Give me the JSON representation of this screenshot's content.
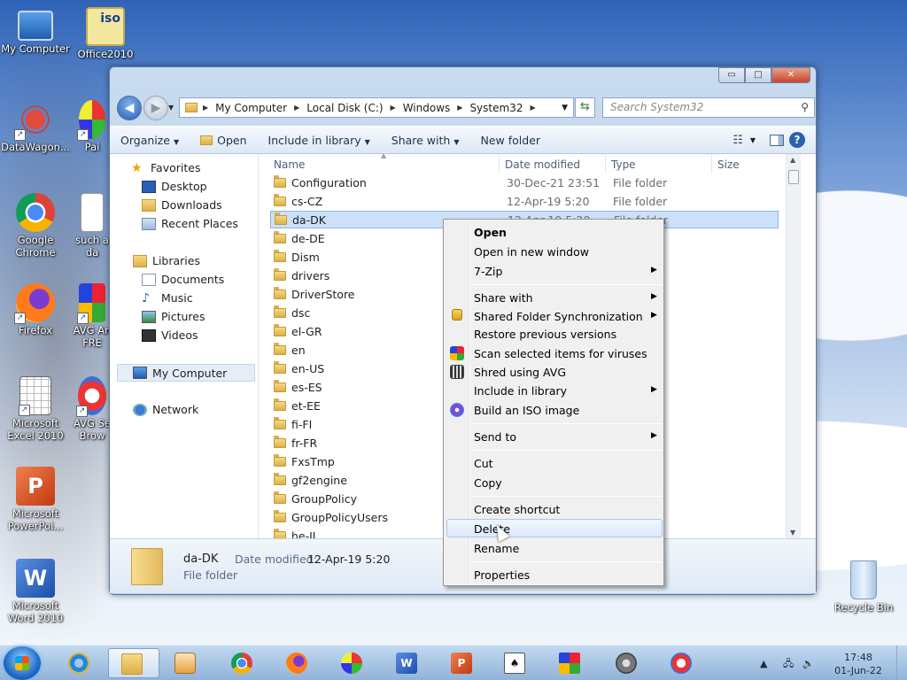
{
  "desktop": {
    "icons": [
      {
        "label": "My Computer"
      },
      {
        "label": "Office2010"
      },
      {
        "label": "DataWagon..."
      },
      {
        "label": "Pai"
      },
      {
        "label": "Google Chrome"
      },
      {
        "label": "such a da"
      },
      {
        "label": "Firefox"
      },
      {
        "label": "AVG An FRE"
      },
      {
        "label": "Microsoft Excel 2010"
      },
      {
        "label": "AVG Se Brow"
      },
      {
        "label": "Microsoft PowerPoi..."
      },
      {
        "label": "Microsoft Word 2010"
      },
      {
        "label": "Recycle Bin"
      }
    ],
    "office_iso_text": "iso"
  },
  "window": {
    "controls": {
      "minimize": "▭",
      "maximize": "□",
      "close": "✕"
    },
    "breadcrumbs": [
      "My Computer",
      "Local Disk (C:)",
      "Windows",
      "System32"
    ],
    "search_placeholder": "Search System32",
    "toolbar": {
      "organize": "Organize",
      "open": "Open",
      "include_in_library": "Include in library",
      "share_with": "Share with",
      "new_folder": "New folder"
    },
    "nav_pane": {
      "favorites": "Favorites",
      "desktop": "Desktop",
      "downloads": "Downloads",
      "recent_places": "Recent Places",
      "libraries": "Libraries",
      "documents": "Documents",
      "music": "Music",
      "pictures": "Pictures",
      "videos": "Videos",
      "my_computer": "My Computer",
      "network": "Network"
    },
    "columns": {
      "name": "Name",
      "date_modified": "Date modified",
      "type": "Type",
      "size": "Size"
    },
    "files": [
      {
        "name": "Configuration",
        "date": "30-Dec-21 23:51",
        "type": "File folder"
      },
      {
        "name": "cs-CZ",
        "date": "12-Apr-19 5:20",
        "type": "File folder"
      },
      {
        "name": "da-DK",
        "date": "12-Apr-19 5:20",
        "type": "File folder"
      },
      {
        "name": "de-DE",
        "date": "",
        "type": ""
      },
      {
        "name": "Dism",
        "date": "",
        "type": ""
      },
      {
        "name": "drivers",
        "date": "",
        "type": ""
      },
      {
        "name": "DriverStore",
        "date": "",
        "type": ""
      },
      {
        "name": "dsc",
        "date": "",
        "type": ""
      },
      {
        "name": "el-GR",
        "date": "",
        "type": ""
      },
      {
        "name": "en",
        "date": "",
        "type": ""
      },
      {
        "name": "en-US",
        "date": "",
        "type": ""
      },
      {
        "name": "es-ES",
        "date": "",
        "type": ""
      },
      {
        "name": "et-EE",
        "date": "",
        "type": ""
      },
      {
        "name": "fi-FI",
        "date": "",
        "type": ""
      },
      {
        "name": "fr-FR",
        "date": "",
        "type": ""
      },
      {
        "name": "FxsTmp",
        "date": "",
        "type": ""
      },
      {
        "name": "gf2engine",
        "date": "",
        "type": ""
      },
      {
        "name": "GroupPolicy",
        "date": "",
        "type": ""
      },
      {
        "name": "GroupPolicyUsers",
        "date": "",
        "type": ""
      },
      {
        "name": "he-IL",
        "date": "",
        "type": ""
      }
    ],
    "selected_index": 2,
    "details": {
      "name": "da-DK",
      "date_label": "Date modified:",
      "date_value": "12-Apr-19 5:20",
      "type": "File folder"
    }
  },
  "context_menu": {
    "items": [
      {
        "label": "Open"
      },
      {
        "label": "Open in new window"
      },
      {
        "label": "7-Zip"
      },
      {
        "label": "Share with"
      },
      {
        "label": "Shared Folder Synchronization"
      },
      {
        "label": "Restore previous versions"
      },
      {
        "label": "Scan selected items for viruses"
      },
      {
        "label": "Shred using AVG"
      },
      {
        "label": "Include in library"
      },
      {
        "label": "Build an ISO image"
      },
      {
        "label": "Send to"
      },
      {
        "label": "Cut"
      },
      {
        "label": "Copy"
      },
      {
        "label": "Create shortcut"
      },
      {
        "label": "Delete"
      },
      {
        "label": "Rename"
      },
      {
        "label": "Properties"
      }
    ],
    "hovered": "Delete"
  },
  "taskbar": {
    "clock_time": "17:48",
    "clock_date": "01-Jun-22"
  },
  "colors": {
    "accent": "#2a5fb4",
    "selection": "#cce0f7",
    "menu_bg": "#f0f0f0"
  }
}
